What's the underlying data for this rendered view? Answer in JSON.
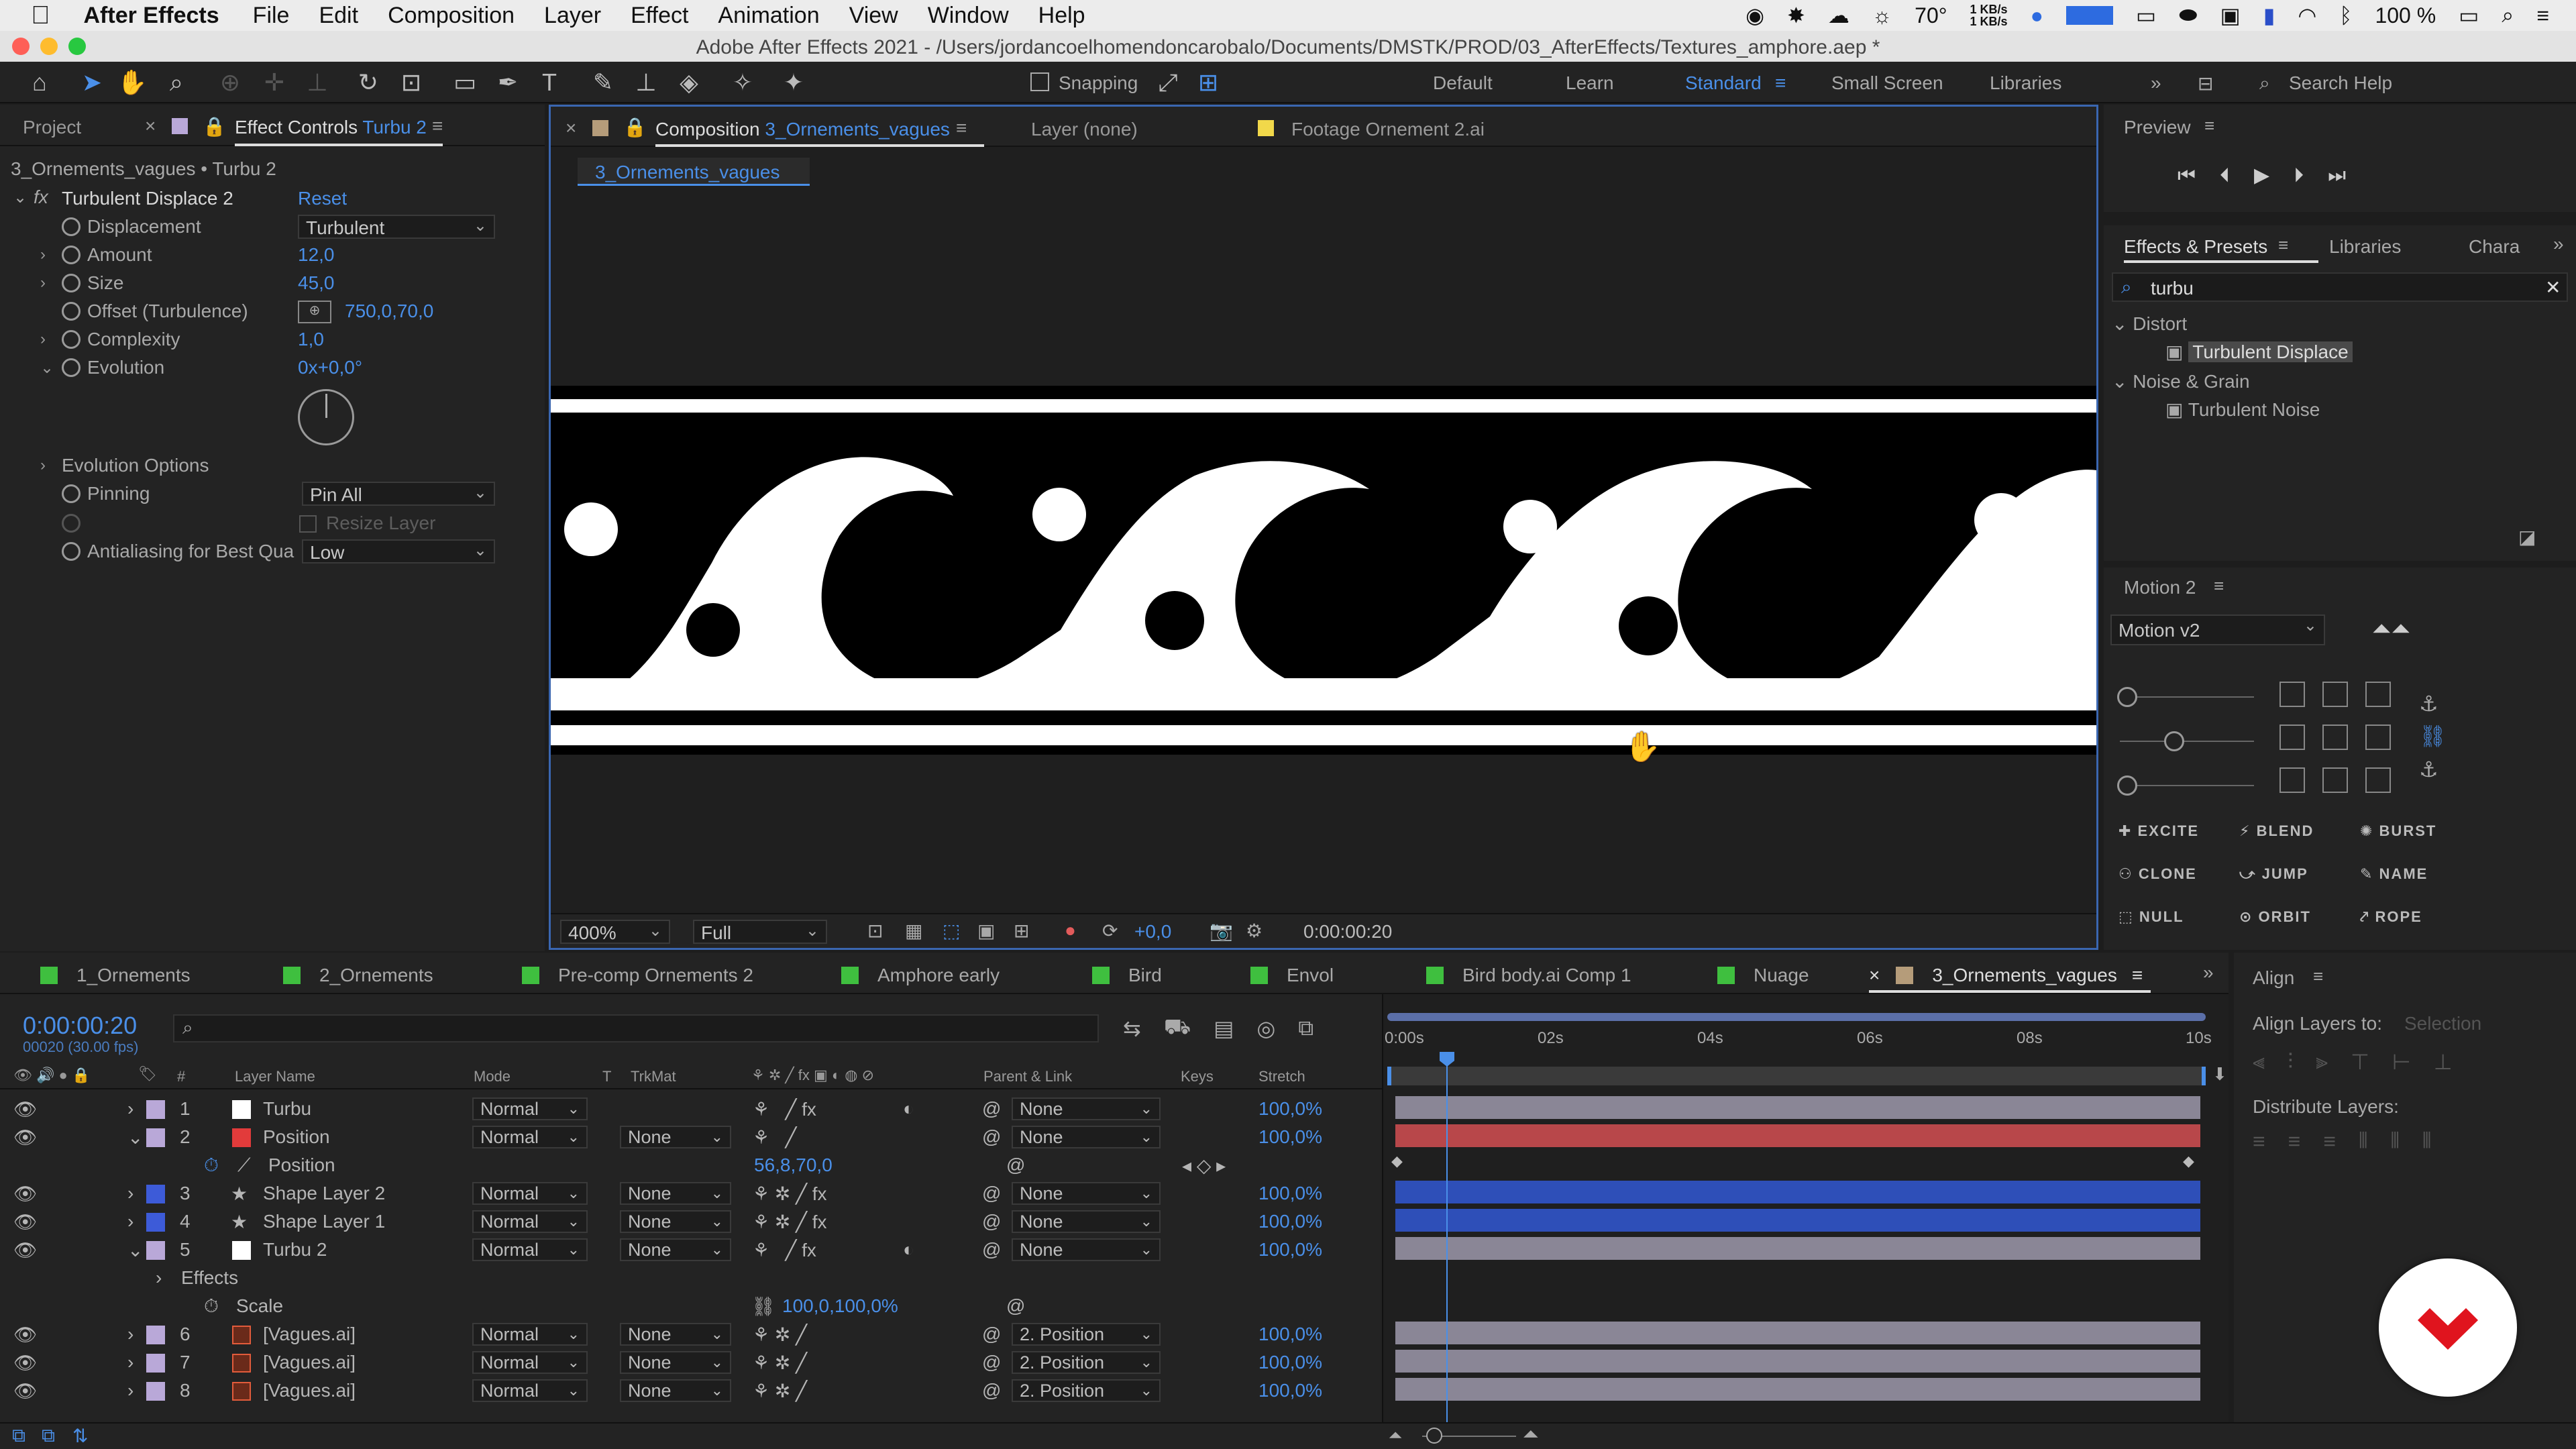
{
  "menubar": {
    "app_name": "After Effects",
    "items": [
      "File",
      "Edit",
      "Composition",
      "Layer",
      "Effect",
      "Animation",
      "View",
      "Window",
      "Help"
    ],
    "temperature": "70°",
    "net_up": "1 KB/s",
    "net_down": "1 KB/s",
    "battery": "100 %"
  },
  "window": {
    "title": "Adobe After Effects 2021 - /Users/jordancoelhomendoncarobalo/Documents/DMSTK/PROD/03_AfterEffects/Textures_amphore.aep *"
  },
  "toolbar": {
    "snapping_label": "Snapping",
    "workspaces": [
      "Default",
      "Learn",
      "Standard",
      "Small Screen",
      "Libraries"
    ],
    "active_workspace": "Standard",
    "search_placeholder": "Search Help"
  },
  "project_panel": {
    "tab_project": "Project",
    "tab_effect_controls": "Effect Controls",
    "effect_controls_target": "Turbu 2",
    "breadcrumb": "3_Ornements_vagues • Turbu 2",
    "effect_name": "Turbulent Displace 2",
    "reset_label": "Reset",
    "fx_label": "fx",
    "props": {
      "displacement_label": "Displacement",
      "displacement_value": "Turbulent",
      "amount_label": "Amount",
      "amount_value": "12,0",
      "size_label": "Size",
      "size_value": "45,0",
      "offset_label": "Offset (Turbulence)",
      "offset_value": "750,0,70,0",
      "complexity_label": "Complexity",
      "complexity_value": "1,0",
      "evolution_label": "Evolution",
      "evolution_value": "0x+0,0°",
      "evolution_options_label": "Evolution Options",
      "pinning_label": "Pinning",
      "pinning_value": "Pin All",
      "resize_layer_label": "Resize Layer",
      "antialiasing_label": "Antialiasing for Best Qua",
      "antialiasing_value": "Low"
    }
  },
  "viewer": {
    "tab_composition": "Composition",
    "comp_name": "3_Ornements_vagues",
    "tab_layer": "Layer (none)",
    "tab_footage": "Footage Ornement 2.ai",
    "breadcrumb": "3_Ornements_vagues",
    "zoom": "400%",
    "resolution": "Full",
    "exposure": "+0,0",
    "timecode": "0:00:00:20"
  },
  "preview_panel": {
    "title": "Preview"
  },
  "effects_presets": {
    "tab_effects": "Effects & Presets",
    "tab_libraries": "Libraries",
    "tab_chara": "Chara",
    "search_value": "turbu",
    "groups": [
      {
        "name": "Distort",
        "items": [
          "Turbulent Displace"
        ]
      },
      {
        "name": "Noise & Grain",
        "items": [
          "Turbulent Noise"
        ]
      }
    ]
  },
  "motion_panel": {
    "title": "Motion 2",
    "preset": "Motion v2",
    "buttons": [
      "EXCITE",
      "BLEND",
      "BURST",
      "CLONE",
      "JUMP",
      "NAME",
      "NULL",
      "ORBIT",
      "ROPE"
    ]
  },
  "align_panel": {
    "title": "Align",
    "align_layers_label": "Align Layers to:",
    "align_target": "Selection",
    "distribute_label": "Distribute Layers:"
  },
  "timeline": {
    "tabs": [
      {
        "label": "1_Ornements",
        "color": "#3fbf3f"
      },
      {
        "label": "2_Ornements",
        "color": "#3fbf3f"
      },
      {
        "label": "Pre-comp Ornements 2",
        "color": "#3fbf3f"
      },
      {
        "label": "Amphore early",
        "color": "#3fbf3f"
      },
      {
        "label": "Bird",
        "color": "#3fbf3f"
      },
      {
        "label": "Envol",
        "color": "#3fbf3f"
      },
      {
        "label": "Bird body.ai Comp 1",
        "color": "#3fbf3f"
      },
      {
        "label": "Nuage",
        "color": "#3fbf3f"
      },
      {
        "label": "3_Ornements_vagues",
        "color": "#b59c7a"
      }
    ],
    "current_time": "0:00:00:20",
    "frame_info": "00020 (30.00 fps)",
    "columns": {
      "layer_name": "Layer Name",
      "mode": "Mode",
      "t": "T",
      "trkmat": "TrkMat",
      "parent": "Parent & Link",
      "keys": "Keys",
      "stretch": "Stretch"
    },
    "ruler": [
      "0:00s",
      "02s",
      "04s",
      "06s",
      "08s",
      "10s"
    ],
    "layers": [
      {
        "num": "1",
        "name": "Turbu",
        "color": "#ffffff",
        "label": "#b9a8d8",
        "mode": "Normal",
        "trkmat": "",
        "parent": "None",
        "stretch": "100,0%",
        "bar": "#8a8696",
        "twirl": "›"
      },
      {
        "num": "2",
        "name": "Position",
        "color": "#e23b3b",
        "label": "#b9a8d8",
        "mode": "Normal",
        "trkmat": "None",
        "parent": "None",
        "stretch": "100,0%",
        "bar": "#b8474a",
        "twirl": "⌄"
      },
      {
        "num": "3",
        "name": "Shape Layer 2",
        "color": "#1a3fd6",
        "label": "#3d5bd8",
        "mode": "Normal",
        "trkmat": "None",
        "parent": "None",
        "stretch": "100,0%",
        "bar": "#2e4fb8",
        "twirl": "›"
      },
      {
        "num": "4",
        "name": "Shape Layer 1",
        "color": "#1a3fd6",
        "label": "#3d5bd8",
        "mode": "Normal",
        "trkmat": "None",
        "parent": "None",
        "stretch": "100,0%",
        "bar": "#2e4fb8",
        "twirl": "›"
      },
      {
        "num": "5",
        "name": "Turbu 2",
        "color": "#ffffff",
        "label": "#b9a8d8",
        "mode": "Normal",
        "trkmat": "None",
        "parent": "None",
        "stretch": "100,0%",
        "bar": "#8a8696",
        "twirl": "⌄"
      },
      {
        "num": "6",
        "name": "[Vagues.ai]",
        "color": "#e25b3b",
        "label": "#b9a8d8",
        "mode": "Normal",
        "trkmat": "None",
        "parent": "2. Position",
        "stretch": "100,0%",
        "bar": "#8a8696",
        "twirl": "›"
      },
      {
        "num": "7",
        "name": "[Vagues.ai]",
        "color": "#e25b3b",
        "label": "#b9a8d8",
        "mode": "Normal",
        "trkmat": "None",
        "parent": "2. Position",
        "stretch": "100,0%",
        "bar": "#8a8696",
        "twirl": "›"
      },
      {
        "num": "8",
        "name": "[Vagues.ai]",
        "color": "#e25b3b",
        "label": "#b9a8d8",
        "mode": "Normal",
        "trkmat": "None",
        "parent": "2. Position",
        "stretch": "100,0%",
        "bar": "#8a8696",
        "twirl": "›"
      }
    ],
    "position_prop": {
      "label": "Position",
      "value": "56,8,70,0"
    },
    "effects_label": "Effects",
    "scale_prop": {
      "label": "Scale",
      "value": "100,0,100,0%"
    }
  }
}
